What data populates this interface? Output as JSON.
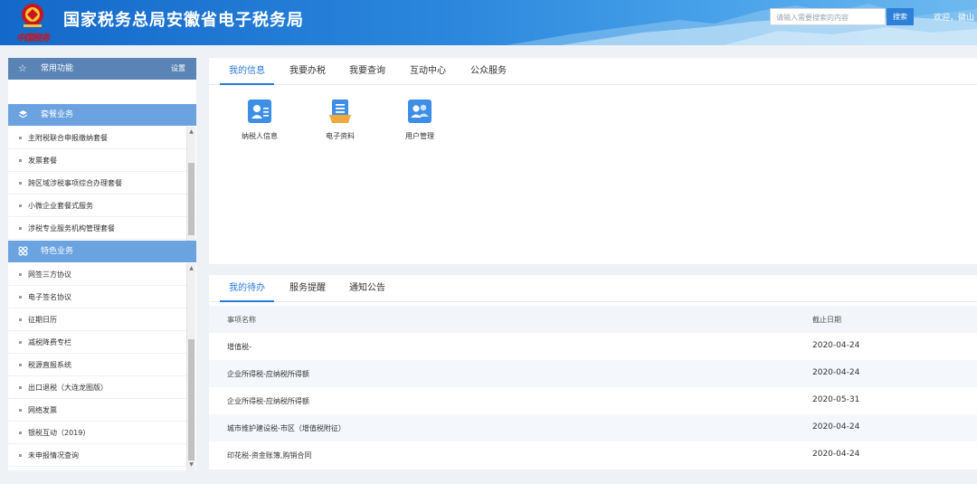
{
  "header": {
    "title": "国家税务总局安徽省电子税务局",
    "emblem_text": "中国税务",
    "search_placeholder": "请输入需要搜索的内容",
    "search_label": "搜索",
    "welcome": "欢迎，徽山"
  },
  "sidebar": {
    "common": {
      "label": "常用功能",
      "settings": "设置"
    },
    "combo": {
      "label": "套餐业务",
      "items": [
        "主附税联合申报缴纳套餐",
        "发票套餐",
        "跨区域涉税事项综合办理套餐",
        "小微企业套餐式服务",
        "涉税专业服务机构管理套餐"
      ]
    },
    "special": {
      "label": "特色业务",
      "items": [
        "网签三方协议",
        "电子签名协议",
        "征期日历",
        "减税降费专栏",
        "税源直报系统",
        "出口退税（大连龙图版）",
        "网络发票",
        "银税互动（2019）",
        "未申报情况查询"
      ]
    }
  },
  "top_panel": {
    "tabs": [
      "我的信息",
      "我要办税",
      "我要查询",
      "互动中心",
      "公众服务"
    ],
    "active_tab": 0,
    "tiles": [
      {
        "label": "纳税人信息",
        "icon": "taxpayer-info-icon"
      },
      {
        "label": "电子资料",
        "icon": "electronic-documents-icon"
      },
      {
        "label": "用户管理",
        "icon": "user-management-icon"
      }
    ]
  },
  "bottom_panel": {
    "tabs": [
      "我的待办",
      "服务提醒",
      "通知公告"
    ],
    "active_tab": 0,
    "columns": [
      "事项名称",
      "截止日期"
    ],
    "rows": [
      {
        "name": "增值税-",
        "date": "2020-04-24"
      },
      {
        "name": "企业所得税-应纳税所得额",
        "date": "2020-04-24"
      },
      {
        "name": "企业所得税-应纳税所得额",
        "date": "2020-05-31"
      },
      {
        "name": "城市维护建设税-市区（增值税附征）",
        "date": "2020-04-24"
      },
      {
        "name": "印花税-资金账簿,购销合同",
        "date": "2020-04-24"
      }
    ]
  },
  "colors": {
    "header_blue": "#1468c9",
    "accent": "#2a7ad5",
    "sidebar_bar": "#6ba3e0",
    "sidebar_bar_dark": "#5b84b6"
  }
}
